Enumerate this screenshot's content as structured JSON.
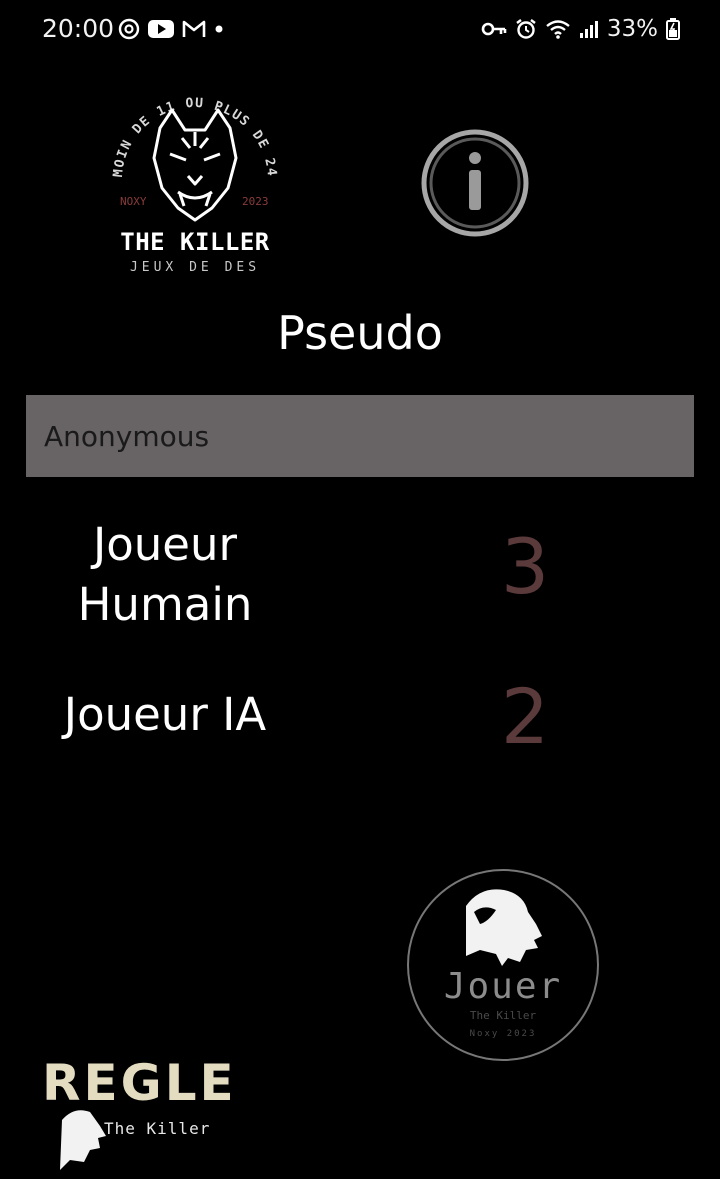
{
  "status_bar": {
    "time": "20:00",
    "left_icons": [
      "chrome-icon",
      "youtube-icon",
      "gmail-icon",
      "dot-icon"
    ],
    "right_icons": [
      "vpn-key-icon",
      "alarm-icon",
      "wifi-icon",
      "signal-icon",
      "battery-charging-icon"
    ],
    "battery": "33%"
  },
  "logo": {
    "arc_text": "MOIN DE 11 OU PLUS DE 24",
    "left_tag": "NOXY",
    "right_tag": "2023",
    "title": "THE KILLER",
    "subtitle": "JEUX DE DES"
  },
  "pseudo": {
    "label": "Pseudo",
    "value": "Anonymous"
  },
  "players": {
    "human_label_line1": "Joueur",
    "human_label_line2": "Humain",
    "human_count": "3",
    "ai_label": "Joueur IA",
    "ai_count": "2"
  },
  "play_button": {
    "label": "Jouer",
    "subtitle": "The Killer",
    "footer": "Noxy 2023"
  },
  "rules_button": {
    "label": "REGLE",
    "subtitle": "The Killer"
  },
  "colors": {
    "background": "#000000",
    "field_background": "#686364",
    "count_color": "#5b3a3b",
    "logo_accent": "#8a3c3c",
    "rules_text": "#e3dcc0"
  }
}
